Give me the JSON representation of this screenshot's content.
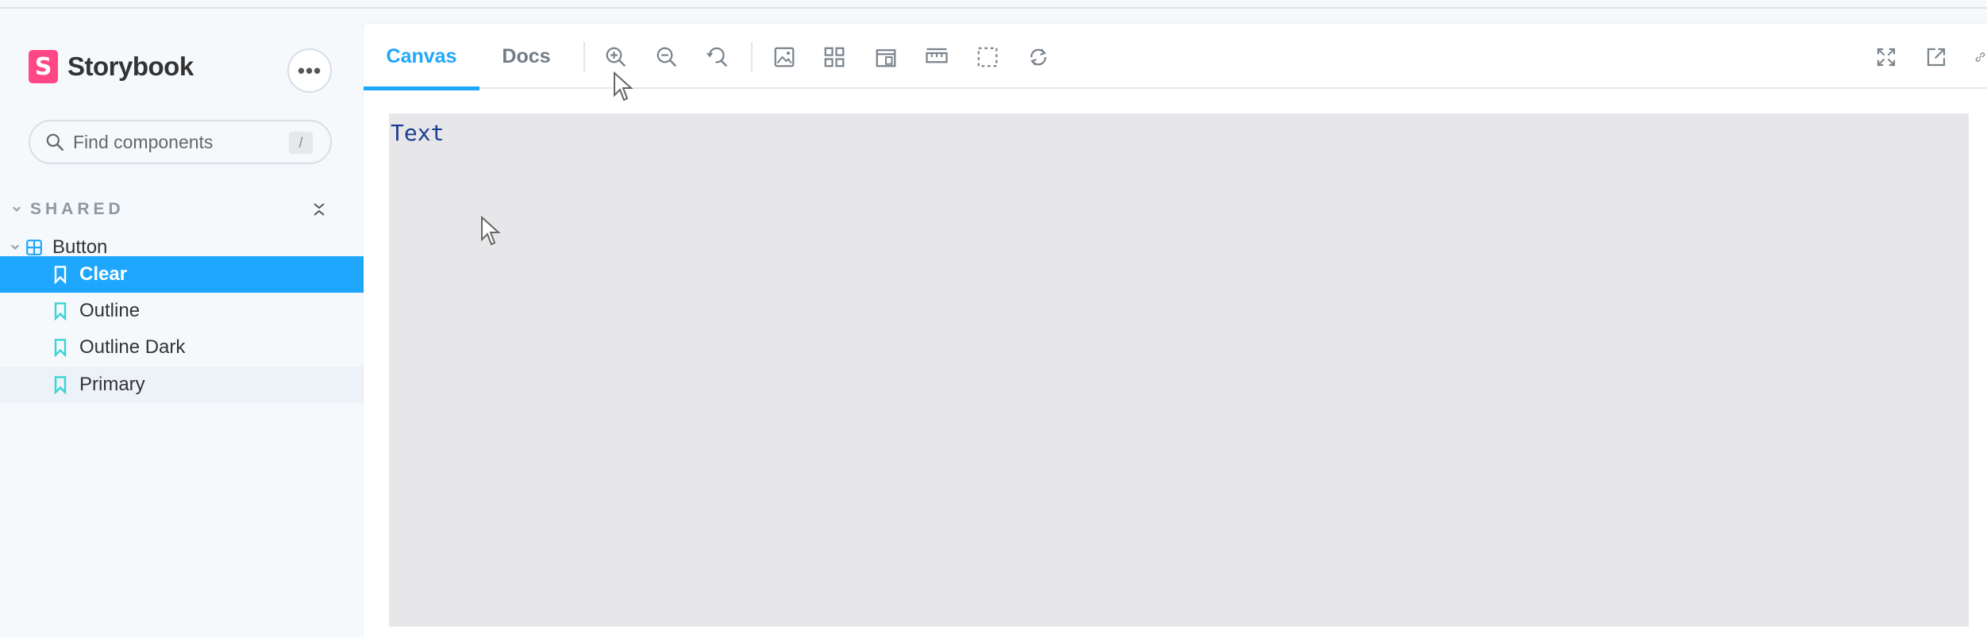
{
  "sidebar": {
    "brand": {
      "logo_letter": "S",
      "name": "Storybook"
    },
    "more_label": "•••",
    "search": {
      "placeholder": "Find components",
      "shortcut": "/"
    },
    "section": {
      "label": "SHARED"
    },
    "component": {
      "label": "Button"
    },
    "stories": [
      {
        "label": "Clear",
        "state": "selected"
      },
      {
        "label": "Outline",
        "state": "normal"
      },
      {
        "label": "Outline Dark",
        "state": "normal"
      },
      {
        "label": "Primary",
        "state": "hovered"
      }
    ]
  },
  "toolbar": {
    "tabs": [
      {
        "label": "Canvas",
        "active": true
      },
      {
        "label": "Docs",
        "active": false
      }
    ],
    "tools": [
      "zoom-in-icon",
      "zoom-out-icon",
      "zoom-reset-icon",
      "background-icon",
      "grid-icon",
      "viewport-icon",
      "measure-icon",
      "outline-icon",
      "remount-icon"
    ],
    "right_tools": [
      "fullscreen-icon",
      "open-new-tab-icon",
      "copy-link-icon"
    ]
  },
  "preview": {
    "text": "Text"
  },
  "colors": {
    "accent": "#1ea7fd",
    "brand": "#ff4785",
    "preview_bg": "#e7e6e9",
    "sidebar_bg": "#f6f9fc"
  }
}
